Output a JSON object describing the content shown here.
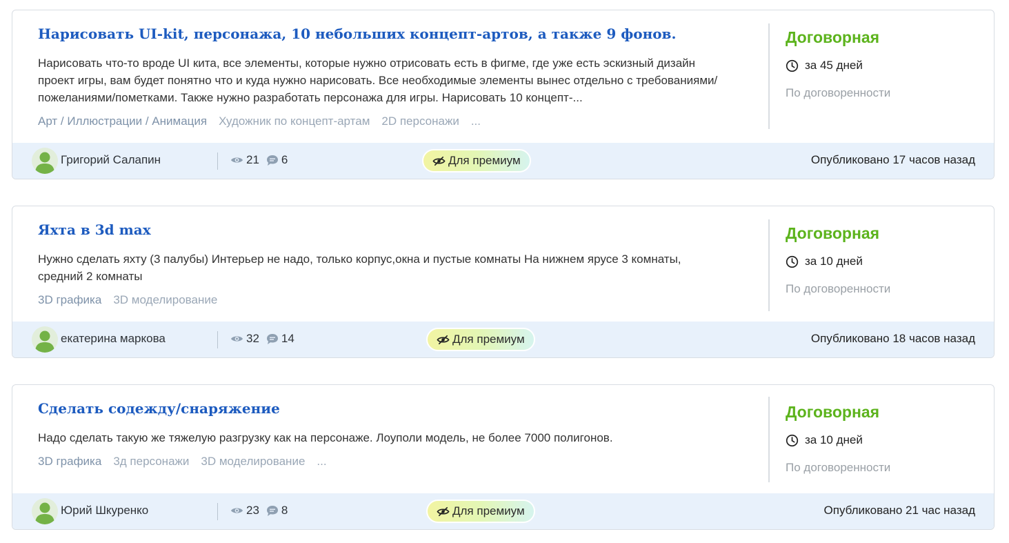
{
  "projects": [
    {
      "title": "Нарисовать UI-kit, персонажа, 10 небольших концепт-артов, а также 9 фонов.",
      "description": "Нарисовать что-то вроде UI кита, все элементы, которые нужно отрисовать есть в фигме, где уже есть эскизный дизайн проект игры, вам будет понятно что и куда нужно нарисовать. Все необходимые элементы вынес отдельно с требованиями/пожеланиями/пометками. Также нужно разработать персонажа для игры. Нарисовать 10 концепт-...",
      "tags": [
        "Арт / Иллюстрации / Анимация",
        "Художник по концепт-артам",
        "2D персонажи"
      ],
      "tags_more": "...",
      "price": "Договорная",
      "deadline": "за 45 дней",
      "terms": "По договоренности",
      "author": "Григорий Салапин",
      "views": "21",
      "comments": "6",
      "premium_label": "Для премиум",
      "published": "Опубликовано 17 часов назад"
    },
    {
      "title": "Яхта в 3d max",
      "description": "Нужно сделать яхту (3 палубы) Интерьер не надо, только корпус,окна и пустые комнаты На нижнем ярусе 3 комнаты, средний 2 комнаты",
      "tags": [
        "3D графика",
        "3D моделирование"
      ],
      "tags_more": "",
      "price": "Договорная",
      "deadline": "за 10 дней",
      "terms": "По договоренности",
      "author": "екатерина маркова",
      "views": "32",
      "comments": "14",
      "premium_label": "Для премиум",
      "published": "Опубликовано 18 часов назад"
    },
    {
      "title": "Сделать содежду/снаряжение",
      "description": "Надо сделать такую же тяжелую разгрузку как на персонаже. Лоуполи модель, не более 7000 полигонов.",
      "tags": [
        "3D графика",
        "3д персонажи",
        "3D моделирование"
      ],
      "tags_more": "...",
      "price": "Договорная",
      "deadline": "за 10 дней",
      "terms": "По договоренности",
      "author": "Юрий Шкуренко",
      "views": "23",
      "comments": "8",
      "premium_label": "Для премиум",
      "published": "Опубликовано 21 час назад"
    }
  ],
  "colors": {
    "title": "#1d5bbf",
    "price": "#5cb31c",
    "footer_bg": "#e8f1fb",
    "tag_primary": "#7e92a9",
    "tag": "#9aa7b6"
  },
  "icons": {
    "clock": "clock-icon",
    "views": "eye-icon",
    "comments": "chat-bubble-icon",
    "premium": "eye-crossed-icon",
    "avatar": "user-silhouette-icon"
  }
}
